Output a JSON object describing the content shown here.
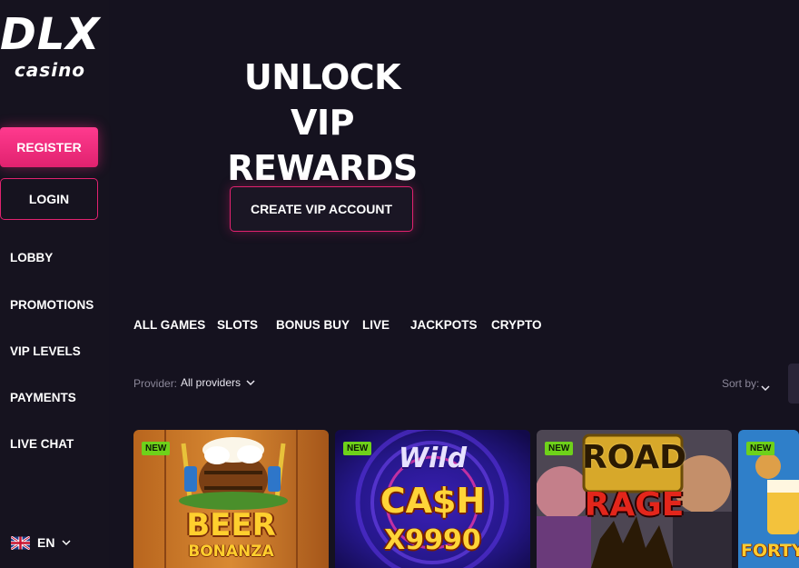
{
  "brand": {
    "name": "DLX",
    "sub": "casino"
  },
  "auth": {
    "register_label": "REGISTER",
    "login_label": "LOGIN"
  },
  "nav": {
    "items": [
      {
        "label": "LOBBY"
      },
      {
        "label": "PROMOTIONS"
      },
      {
        "label": "VIP LEVELS"
      },
      {
        "label": "PAYMENTS"
      },
      {
        "label": "LIVE CHAT"
      }
    ]
  },
  "language": {
    "code": "EN",
    "flag_icon": "uk-flag-icon"
  },
  "hero": {
    "line1": "UNLOCK",
    "line2": "VIP REWARDS",
    "cta_label": "CREATE VIP ACCOUNT"
  },
  "tabs": [
    {
      "label": "ALL GAMES"
    },
    {
      "label": "SLOTS"
    },
    {
      "label": "BONUS BUY"
    },
    {
      "label": "LIVE"
    },
    {
      "label": "JACKPOTS"
    },
    {
      "label": "CRYPTO"
    }
  ],
  "filters": {
    "provider_label": "Provider:",
    "provider_value": "All providers",
    "sort_label": "Sort by:"
  },
  "games": [
    {
      "title_line1": "BEER",
      "title_line2": "BONANZA",
      "badge": "NEW"
    },
    {
      "title_line1": "Wild",
      "title_line2": "CA$H",
      "title_line3": "X9990",
      "badge": "NEW"
    },
    {
      "title_line1": "ROAD",
      "title_line2": "RAGE",
      "badge": "NEW"
    },
    {
      "title_line1": "FORTY",
      "badge": "NEW"
    }
  ],
  "colors": {
    "background": "#15121f",
    "accent": "#e1226f",
    "badge": "#6ed11a",
    "muted_text": "#8b8799"
  }
}
